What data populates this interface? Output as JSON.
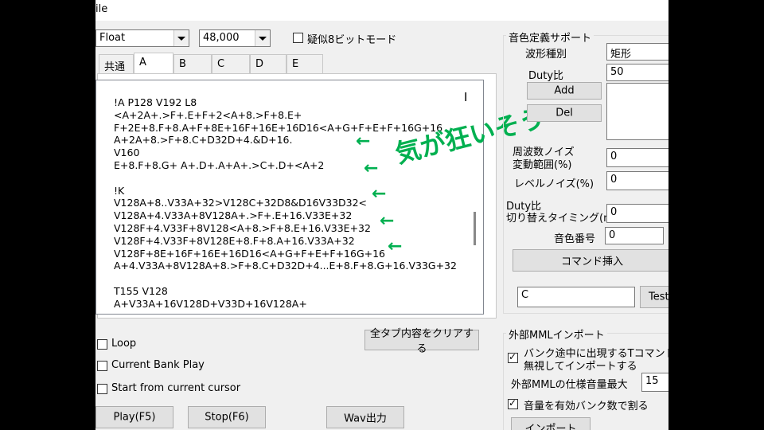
{
  "window": {
    "title": "ile"
  },
  "toolbar": {
    "format_value": "Float",
    "rate_value": "48,000",
    "pseudo8bit_label": "疑似8ビットモード"
  },
  "tabs": [
    "共通",
    "A",
    "B",
    "C",
    "D",
    "E"
  ],
  "editor": {
    "lines": [
      "!A P128 V192 L8",
      "<A+2A+.>F+.E+F+2<A+8.>F+8.E+",
      "F+2E+8.F+8.A+F+8E+16F+16E+16D16<A+G+F+E+F+16G+16",
      "A+2A+8.>F+8.C+D32D+4.&D+16.",
      "V160",
      "E+8.F+8.G+ A+.D+.A+A+.>C+.D+<A+2",
      "",
      "!K",
      "V128A+8..V33A+32>V128C+32D8&D16V33D32<",
      "V128A+4.V33A+8V128A+.>F+.E+16.V33E+32",
      "V128F+4.V33F+8V128<A+8.>F+8.E+16.V33E+32",
      "V128F+4.V33F+8V128E+8.F+8.A+16.V33A+32",
      "V128F+8E+16F+16E+16D16<A+G+F+E+F+16G+16",
      "A+4.V33A+8V128A+8.>F+8.C+D32D+4...E+8.F+8.G+16.V33G+32",
      "",
      "T155 V128",
      "A+V33A+16V128D+V33D+16V128A+"
    ],
    "overlay_text": "気が狂いそう",
    "accent_color": "#00b050"
  },
  "playback": {
    "clear_tabs_label": "全タブ内容をクリアする",
    "loop_label": "Loop",
    "current_bank_label": "Current Bank Play",
    "from_cursor_label": "Start from current cursor",
    "play_label": "Play(F5)",
    "stop_label": "Stop(F6)",
    "wav_label": "Wav出力"
  },
  "tone_support": {
    "group_title": "音色定義サポート",
    "waveform_label": "波形種別",
    "waveform_value": "矩形",
    "duty_label": "Duty比",
    "duty_value": "50",
    "add_label": "Add",
    "del_label": "Del",
    "freq_noise_label_1": "周波数ノイズ",
    "freq_noise_label_2": "変動範囲(%)",
    "freq_noise_value": "0",
    "level_noise_label": "レベルノイズ(%)",
    "level_noise_value": "0",
    "duty_switch_label_1": "Duty比",
    "duty_switch_label_2": "切り替えタイミング(ms)",
    "duty_switch_value": "0",
    "tone_number_label": "音色番号",
    "tone_number_value": "0",
    "insert_command_label": "コマンド挿入",
    "command_value": "C",
    "test_label": "Test"
  },
  "mml_import": {
    "group_title": "外部MMLインポート",
    "ignore_t_label_1": "バンク途中に出現するTコマンドを",
    "ignore_t_label_2": "無視してインポートする",
    "max_volume_label": "外部MMLの仕様音量最大",
    "max_volume_value": "15",
    "divide_label": "音量を有効バンク数で割る",
    "import_label": "インポート"
  }
}
